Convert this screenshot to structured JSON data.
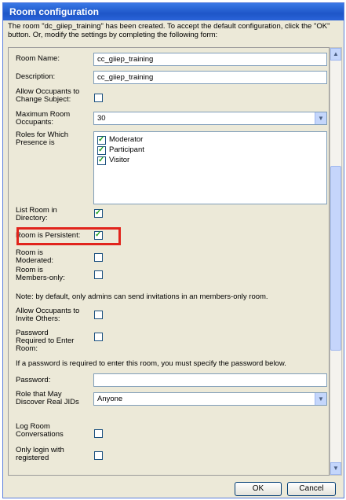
{
  "window": {
    "title": "Room configuration"
  },
  "intro": "The room \"dc_giiep_training\" has been created. To accept the default configuration, click the \"OK\" button. Or, modify the settings by completing the following form:",
  "form": {
    "room_name_label": "Room Name:",
    "room_name_value": "cc_giiep_training",
    "description_label": "Description:",
    "description_value": "cc_giiep_training",
    "allow_change_subject_label": "Allow Occupants to Change Subject:",
    "allow_change_subject_checked": false,
    "max_occupants_label": "Maximum Room Occupants:",
    "max_occupants_value": "30",
    "roles_label": "Roles for Which Presence is",
    "roles": [
      {
        "label": "Moderator",
        "checked": true
      },
      {
        "label": "Participant",
        "checked": true
      },
      {
        "label": "Visitor",
        "checked": true
      }
    ],
    "list_in_directory_label": "List Room in Directory:",
    "list_in_directory_checked": true,
    "persistent_label": "Room is Persistent:",
    "persistent_checked": true,
    "moderated_label": "Room is Moderated:",
    "moderated_checked": false,
    "members_only_label": "Room is Members-only:",
    "members_only_checked": false,
    "members_note": "Note: by default, only admins can send invitations in an members-only room.",
    "allow_invite_label": "Allow Occupants to Invite Others:",
    "allow_invite_checked": false,
    "password_required_label": "Password Required to Enter Room:",
    "password_required_checked": false,
    "password_note": "If a password is required to enter this room, you must specify the password below.",
    "password_label": "Password:",
    "password_value": "",
    "discover_jids_label": "Role that May Discover Real JIDs",
    "discover_jids_value": "Anyone",
    "log_conversations_label": "Log Room Conversations",
    "log_conversations_checked": false,
    "login_registered_label": "Only login with registered",
    "login_registered_checked": false
  },
  "buttons": {
    "ok": "OK",
    "cancel": "Cancel"
  },
  "icons": {
    "dropdown": "chevron-down-icon",
    "scroll_up": "arrow-up-icon",
    "scroll_down": "arrow-down-icon"
  },
  "colors": {
    "titlebar": "#1e56c8",
    "highlight": "#e1241c",
    "check": "#21a121"
  }
}
